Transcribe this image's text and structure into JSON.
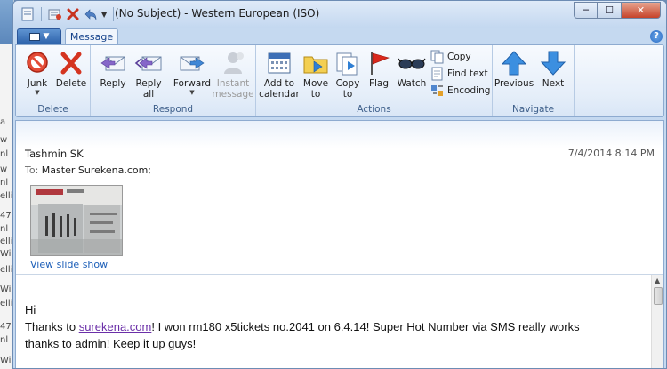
{
  "window": {
    "title": "(No Subject) - Western European (ISO)",
    "controls": {
      "minimize": "─",
      "maximize": "☐",
      "close": "✕"
    }
  },
  "tabs": {
    "message": "Message",
    "help": "?"
  },
  "ribbon": {
    "groups": {
      "delete": "Delete",
      "respond": "Respond",
      "actions": "Actions",
      "navigate": "Navigate"
    },
    "buttons": {
      "junk": "Junk",
      "delete": "Delete",
      "reply": "Reply",
      "reply_all_1": "Reply",
      "reply_all_2": "all",
      "forward": "Forward",
      "instant_1": "Instant",
      "instant_2": "message",
      "add_calendar_1": "Add to",
      "add_calendar_2": "calendar",
      "move_1": "Move",
      "move_2": "to",
      "copy_1": "Copy",
      "copy_2": "to",
      "flag": "Flag",
      "watch": "Watch",
      "copy": "Copy",
      "find_text": "Find text",
      "encoding": "Encoding",
      "previous": "Previous",
      "next": "Next"
    }
  },
  "message": {
    "from": "Tashmin SK",
    "date": "7/4/2014 8:14 PM",
    "to_label": "To:",
    "to_value": "Master Surekena.com;",
    "slideshow_link": "View slide show",
    "body": {
      "greeting": "Hi",
      "line1_pre": "Thanks to ",
      "line1_link": "surekena.com",
      "line1_post": "! I won rm180 x5tickets no.2041  on 6.4.14! Super Hot Number via SMS really works",
      "line2": "thanks to admin! Keep it up guys!"
    }
  },
  "background_window": {
    "fragments": [
      "a",
      "w",
      "nl",
      "w",
      "nl",
      "elli",
      "47",
      "nl",
      "elli",
      "Win",
      "elli",
      "Win",
      "elli",
      "47",
      "nl",
      "Wir"
    ]
  }
}
